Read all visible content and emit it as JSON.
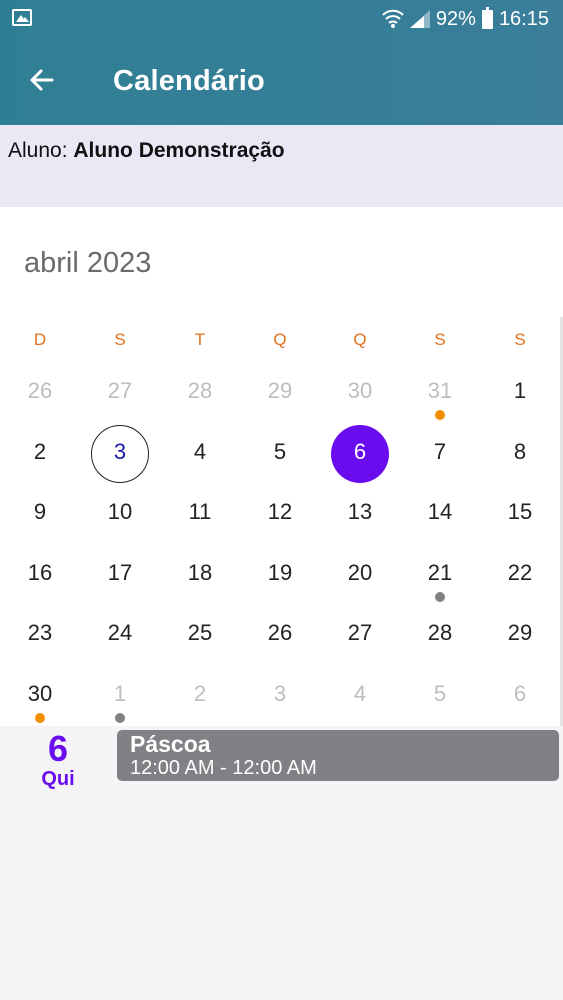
{
  "status_bar": {
    "battery": "92%",
    "time": "16:15",
    "icons": [
      "image-icon",
      "wifi-icon",
      "signal-icon",
      "battery-icon"
    ]
  },
  "app_bar": {
    "title": "Calendário",
    "back_icon": "arrow-left-icon"
  },
  "student": {
    "label": "Aluno:",
    "name": "Aluno Demonstração"
  },
  "calendar": {
    "month_title": "abril 2023",
    "weekdays": [
      "D",
      "S",
      "T",
      "Q",
      "Q",
      "S",
      "S"
    ],
    "weeks": [
      [
        {
          "d": "26",
          "other": true
        },
        {
          "d": "27",
          "other": true
        },
        {
          "d": "28",
          "other": true
        },
        {
          "d": "29",
          "other": true
        },
        {
          "d": "30",
          "other": true
        },
        {
          "d": "31",
          "other": true,
          "dot": "orange"
        },
        {
          "d": "1"
        }
      ],
      [
        {
          "d": "2"
        },
        {
          "d": "3",
          "today": true
        },
        {
          "d": "4"
        },
        {
          "d": "5"
        },
        {
          "d": "6",
          "selected": true
        },
        {
          "d": "7"
        },
        {
          "d": "8"
        }
      ],
      [
        {
          "d": "9"
        },
        {
          "d": "10"
        },
        {
          "d": "11"
        },
        {
          "d": "12"
        },
        {
          "d": "13"
        },
        {
          "d": "14"
        },
        {
          "d": "15"
        }
      ],
      [
        {
          "d": "16"
        },
        {
          "d": "17"
        },
        {
          "d": "18"
        },
        {
          "d": "19"
        },
        {
          "d": "20"
        },
        {
          "d": "21",
          "dot": "gray"
        },
        {
          "d": "22"
        }
      ],
      [
        {
          "d": "23"
        },
        {
          "d": "24"
        },
        {
          "d": "25"
        },
        {
          "d": "26"
        },
        {
          "d": "27"
        },
        {
          "d": "28"
        },
        {
          "d": "29"
        }
      ],
      [
        {
          "d": "30",
          "dot": "orange"
        },
        {
          "d": "1",
          "other": true,
          "dot": "gray"
        },
        {
          "d": "2",
          "other": true
        },
        {
          "d": "3",
          "other": true
        },
        {
          "d": "4",
          "other": true
        },
        {
          "d": "5",
          "other": true
        },
        {
          "d": "6",
          "other": true
        }
      ]
    ],
    "colors": {
      "weekday": "#e3701e",
      "selected": "#6a0dee",
      "dot_orange": "#f28c00",
      "dot_gray": "#808080"
    }
  },
  "events": {
    "day_number": "6",
    "day_name": "Qui",
    "items": [
      {
        "title": "Páscoa",
        "time": "12:00 AM - 12:00 AM"
      }
    ]
  },
  "colors": {
    "app_bar": "#34809a",
    "student_bar": "#ebe8f6",
    "event_card": "#828084"
  }
}
